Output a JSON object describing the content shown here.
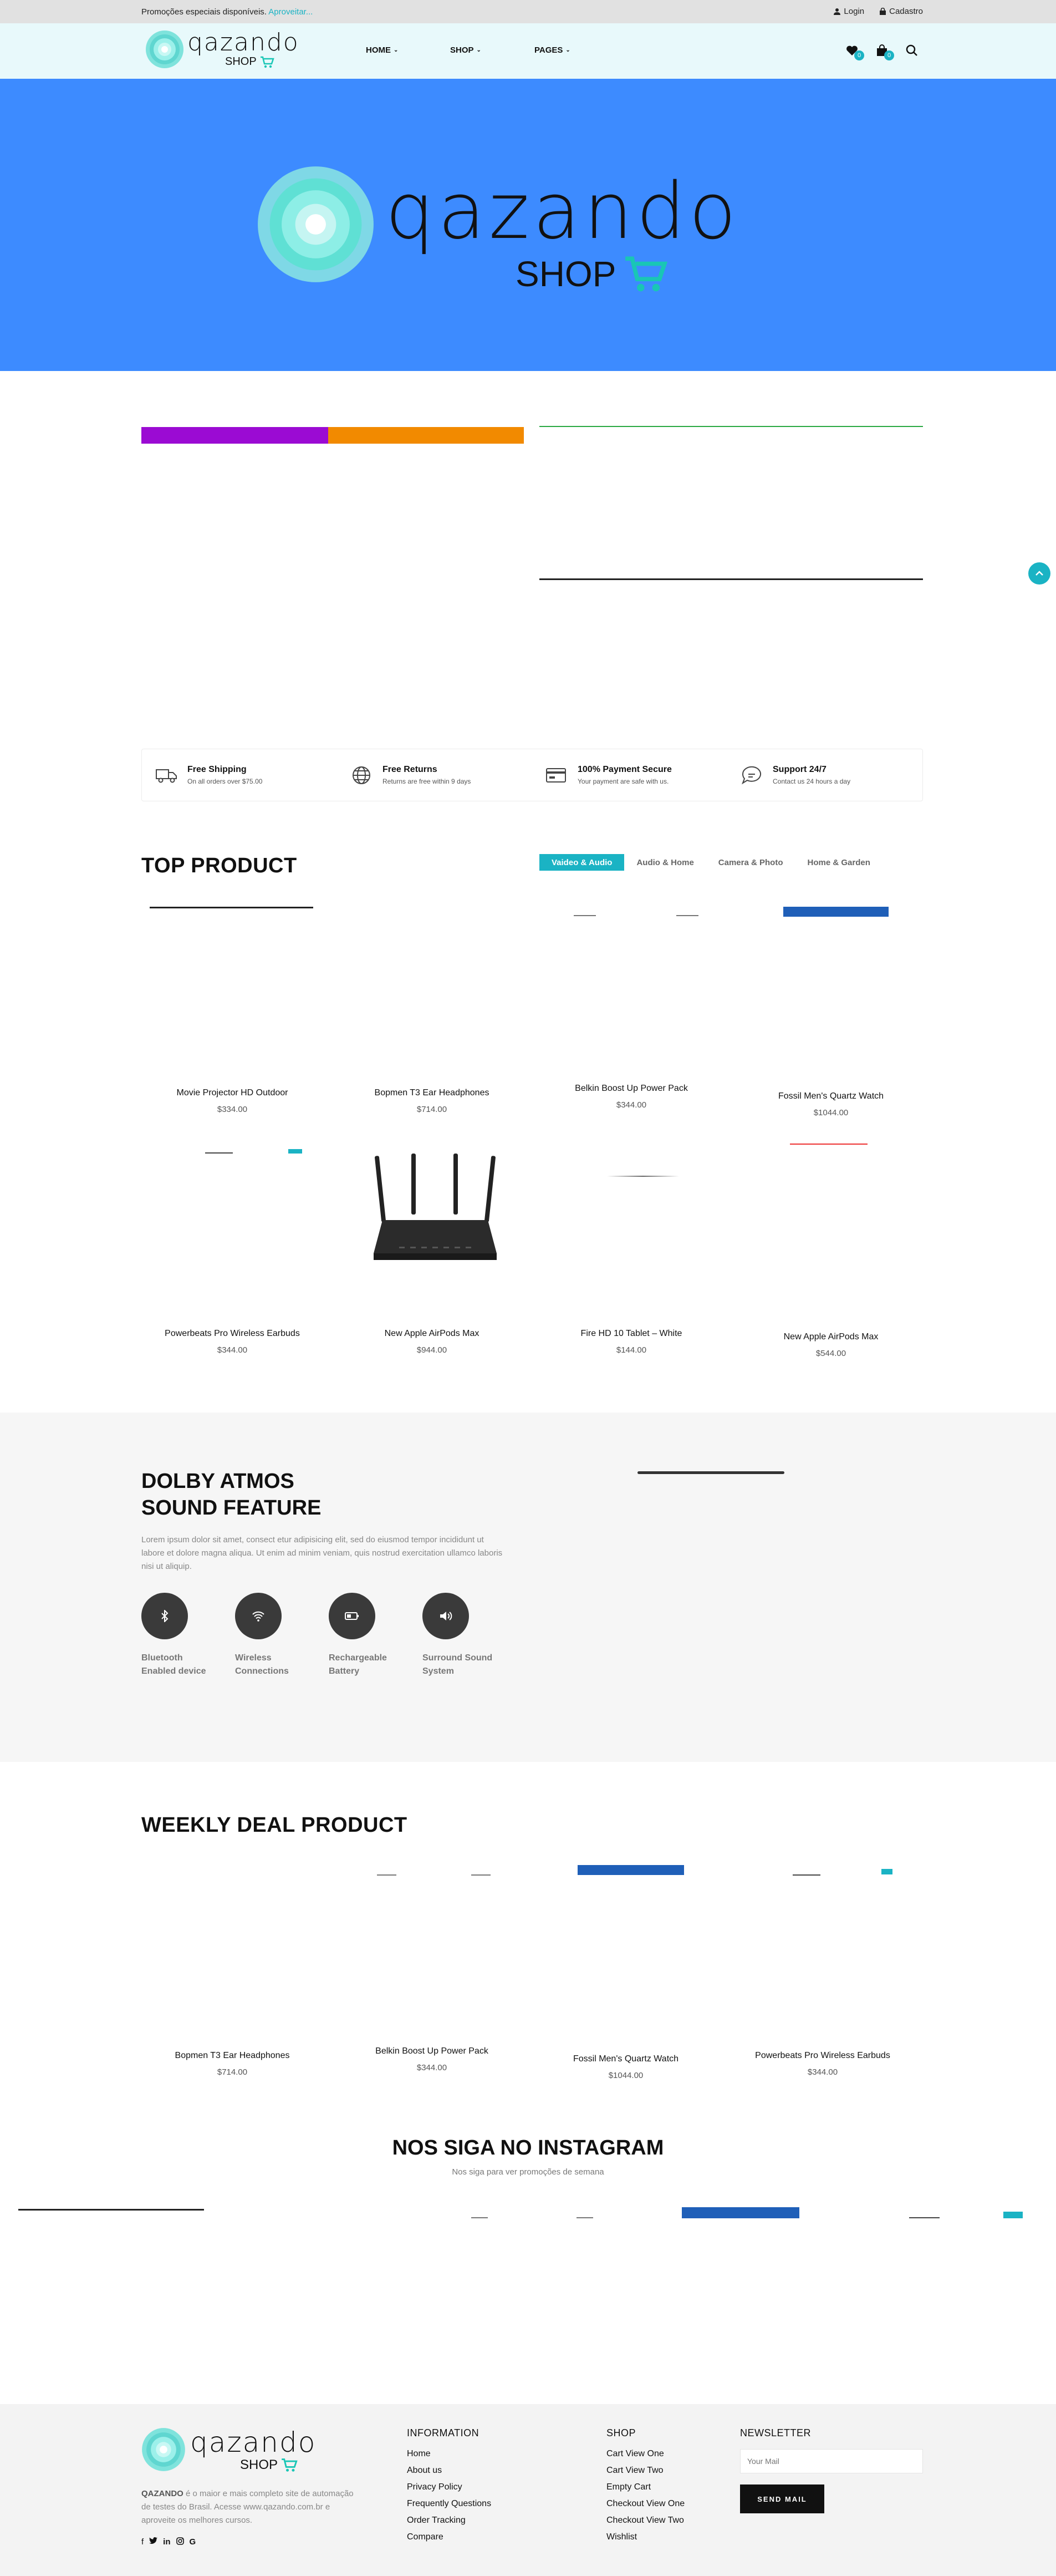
{
  "topbar": {
    "promo_text": "Promoções especiais disponíveis.",
    "promo_link": "Aproveitar...",
    "login": "Login",
    "register": "Cadastro"
  },
  "brand": {
    "logo_word": "qazando",
    "logo_shop": "SHOP"
  },
  "nav": {
    "home": "HOME",
    "shop": "SHOP",
    "pages": "PAGES"
  },
  "header_icons": {
    "wishlist_count": "0",
    "cart_count": "0"
  },
  "features": [
    {
      "title": "Free Shipping",
      "subtitle": "On all orders over $75.00",
      "icon": "truck-icon"
    },
    {
      "title": "Free Returns",
      "subtitle": "Returns are free within 9 days",
      "icon": "globe-icon"
    },
    {
      "title": "100% Payment Secure",
      "subtitle": "Your payment are safe with us.",
      "icon": "credit-card-icon"
    },
    {
      "title": "Support 24/7",
      "subtitle": "Contact us 24 hours a day",
      "icon": "support-icon"
    }
  ],
  "top_product": {
    "title": "TOP PRODUCT",
    "tabs": [
      "Vaideo & Audio",
      "Audio & Home",
      "Camera & Photo",
      "Home & Garden"
    ],
    "products": [
      {
        "name": "Movie Projector HD Outdoor",
        "price": "$334.00"
      },
      {
        "name": "Bopmen T3 Ear Headphones",
        "price": "$714.00"
      },
      {
        "name": "Belkin Boost Up Power Pack",
        "price": "$344.00"
      },
      {
        "name": "Fossil Men's Quartz Watch",
        "price": "$1044.00"
      },
      {
        "name": "Powerbeats Pro Wireless Earbuds",
        "price": "$344.00"
      },
      {
        "name": "New Apple AirPods Max",
        "price": "$944.00"
      },
      {
        "name": "Fire HD 10 Tablet – White",
        "price": "$144.00"
      },
      {
        "name": "New Apple AirPods Max",
        "price": "$544.00"
      }
    ]
  },
  "dolby": {
    "title_line1": "DOLBY ATMOS",
    "title_line2": "SOUND FEATURE",
    "description": "Lorem ipsum dolor sit amet, consect etur adipisicing elit, sed do eiusmod tempor incididunt ut labore et dolore magna aliqua. Ut enim ad minim veniam, quis nostrud exercitation ullamco laboris nisi ut aliquip.",
    "features": [
      {
        "line1": "Bluetooth",
        "line2": "Enabled device",
        "icon": "bluetooth-icon"
      },
      {
        "line1": "Wireless",
        "line2": "Connections",
        "icon": "wifi-icon"
      },
      {
        "line1": "Rechargeable",
        "line2": "Battery",
        "icon": "battery-icon"
      },
      {
        "line1": "Surround Sound",
        "line2": "System",
        "icon": "speaker-icon"
      }
    ]
  },
  "weekly_deal": {
    "title": "WEEKLY DEAL PRODUCT",
    "products": [
      {
        "name": "Bopmen T3 Ear Headphones",
        "price": "$714.00"
      },
      {
        "name": "Belkin Boost Up Power Pack",
        "price": "$344.00"
      },
      {
        "name": "Fossil Men's Quartz Watch",
        "price": "$1044.00"
      },
      {
        "name": "Powerbeats Pro Wireless Earbuds",
        "price": "$344.00"
      }
    ]
  },
  "instagram": {
    "title": "NOS SIGA NO INSTAGRAM",
    "subtitle": "Nos siga para ver promoções de semana"
  },
  "footer": {
    "about_brand": "QAZANDO",
    "about_text": " é o maior e mais completo site de automação de testes do Brasil. Acesse www.qazando.com.br e aproveite os melhores cursos.",
    "information_title": "INFORMATION",
    "information_links": [
      "Home",
      "About us",
      "Privacy Policy",
      "Frequently Questions",
      "Order Tracking",
      "Compare"
    ],
    "shop_title": "SHOP",
    "shop_links": [
      "Cart View One",
      "Cart View Two",
      "Empty Cart",
      "Checkout View One",
      "Checkout View Two",
      "Wishlist"
    ],
    "newsletter_title": "NEWSLETTER",
    "newsletter_placeholder": "Your Mail",
    "newsletter_button": "SEND MAIL"
  },
  "colors": {
    "accent": "#1ab3c4",
    "hero_bg": "#3d8bff",
    "banner_purple": "#9b0bd3",
    "banner_orange": "#f28a00"
  }
}
